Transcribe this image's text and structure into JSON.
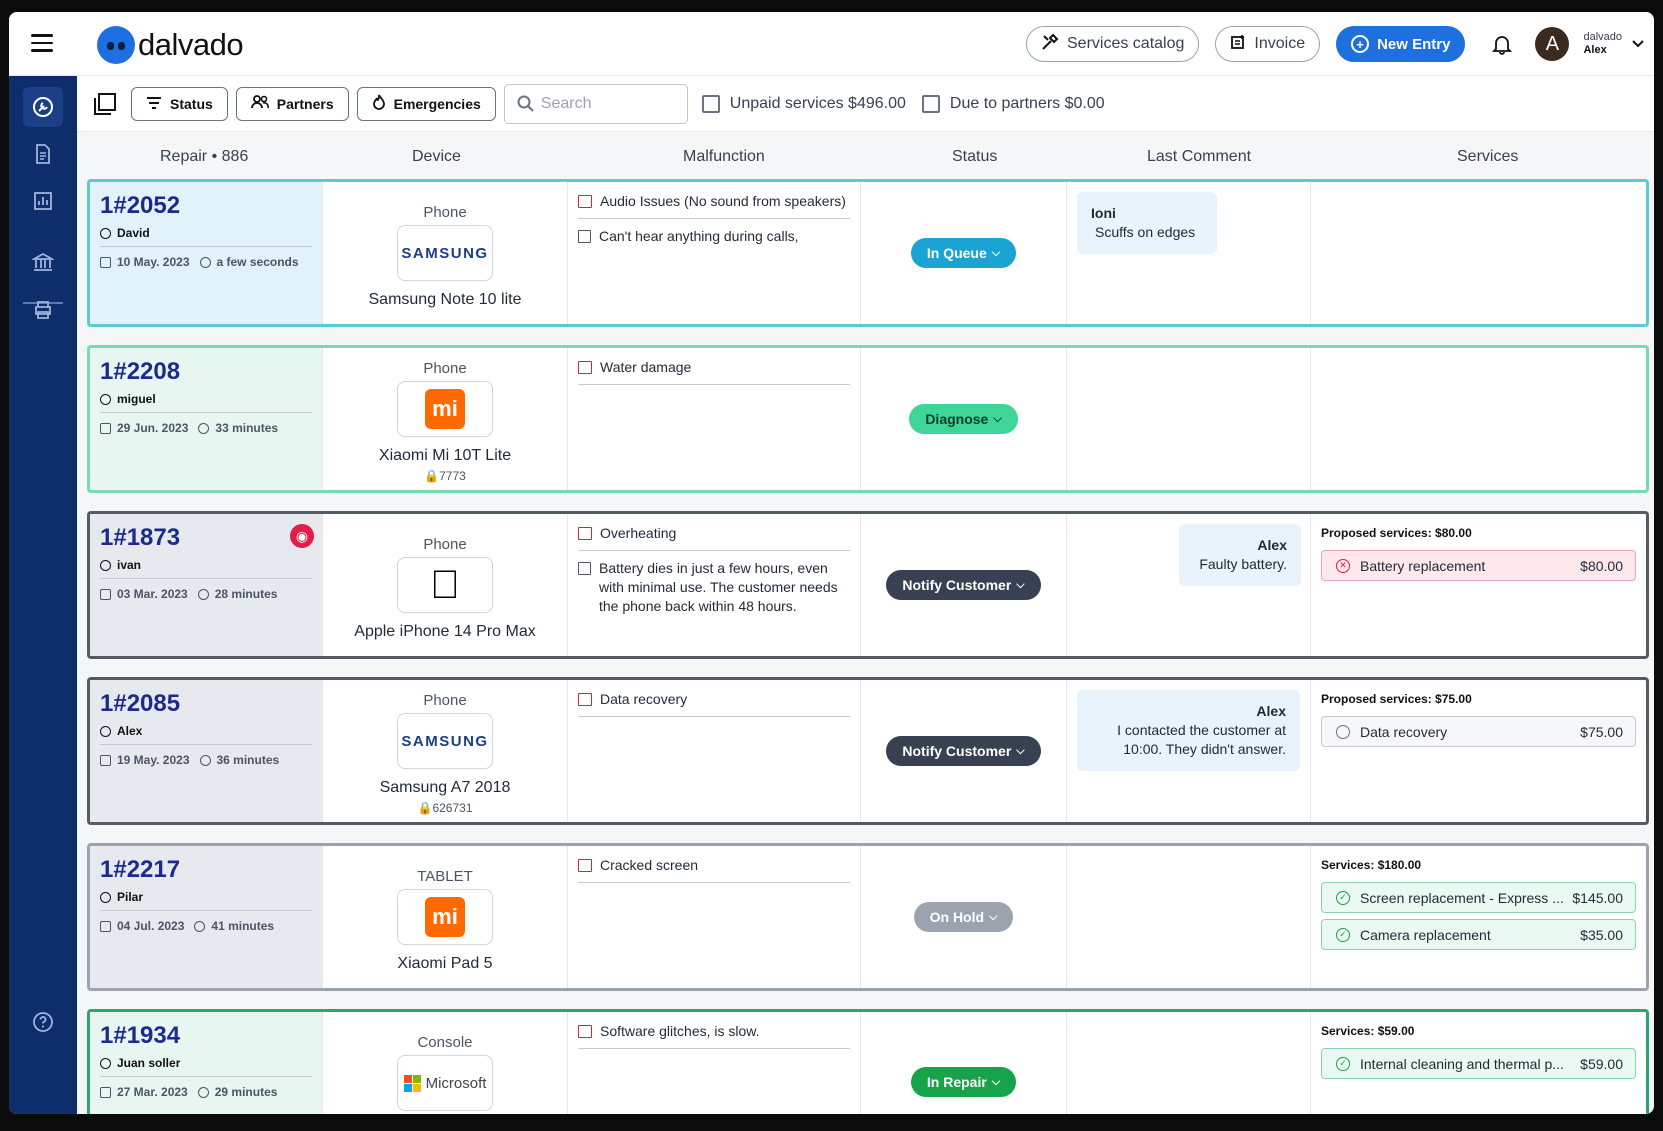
{
  "brand": {
    "name": "dalvado",
    "accent": "#1e6fe0",
    "sidebar_bg": "#0d2d6b"
  },
  "topbar": {
    "services_catalog": "Services catalog",
    "invoice": "Invoice",
    "new_entry": "New Entry",
    "user": {
      "initial": "A",
      "org": "dalvado",
      "name": "Alex"
    }
  },
  "toolbar": {
    "status": "Status",
    "partners": "Partners",
    "emergencies": "Emergencies",
    "search_placeholder": "Search",
    "unpaid": "Unpaid services $496.00",
    "due_partners": "Due to partners $0.00"
  },
  "headers": {
    "repair": "Repair",
    "repair_count": "886",
    "device": "Device",
    "malfunction": "Malfunction",
    "status": "Status",
    "last_comment": "Last Comment",
    "services": "Services"
  },
  "rows": [
    {
      "id": "1#2052",
      "customer": "David",
      "date": "10 May. 2023",
      "ago": "a few seconds",
      "device_type": "Phone",
      "device_name": "Samsung Note 10 lite",
      "brand_logo": "SAMSUNG",
      "pin": "",
      "malfunction": "Audio Issues (No sound from speakers)",
      "note": "Can't hear anything during calls,",
      "status": "In Queue",
      "comment_author": "Ioni",
      "comment_text": "Scuffs on edges",
      "services_header": "",
      "services": []
    },
    {
      "id": "1#2208",
      "customer": "miguel",
      "date": "29 Jun. 2023",
      "ago": "33 minutes",
      "device_type": "Phone",
      "device_name": "Xiaomi Mi 10T Lite",
      "brand_logo": "mi",
      "pin": "7773",
      "malfunction": "Water damage",
      "note": "",
      "status": "Diagnose",
      "comment_author": "",
      "comment_text": "",
      "services_header": "",
      "services": []
    },
    {
      "id": "1#1873",
      "customer": "ivan",
      "date": "03 Mar. 2023",
      "ago": "28 minutes",
      "device_type": "Phone",
      "device_name": "Apple iPhone 14 Pro Max",
      "brand_logo": "apple",
      "pin": "",
      "malfunction": "Overheating",
      "note": "Battery dies in just a few hours, even with minimal use. The customer needs the phone back within 48 hours.",
      "status": "Notify Customer",
      "comment_author": "Alex",
      "comment_text": "Faulty battery.",
      "services_header": "Proposed services: $80.00",
      "services": [
        {
          "name": "Battery replacement",
          "price": "$80.00",
          "state": "rejected"
        }
      ]
    },
    {
      "id": "1#2085",
      "customer": "Alex",
      "date": "19 May. 2023",
      "ago": "36 minutes",
      "device_type": "Phone",
      "device_name": "Samsung A7 2018",
      "brand_logo": "SAMSUNG",
      "pin": "626731",
      "malfunction": "Data recovery",
      "note": "",
      "status": "Notify Customer",
      "comment_author": "Alex",
      "comment_text": "I contacted the customer at 10:00. They didn't answer.",
      "services_header": "Proposed services: $75.00",
      "services": [
        {
          "name": "Data recovery",
          "price": "$75.00",
          "state": "open"
        }
      ]
    },
    {
      "id": "1#2217",
      "customer": "Pilar",
      "date": "04 Jul. 2023",
      "ago": "41 minutes",
      "device_type": "TABLET",
      "device_name": "Xiaomi Pad 5",
      "brand_logo": "mi",
      "pin": "",
      "malfunction": "Cracked screen",
      "note": "",
      "status": "On Hold",
      "comment_author": "",
      "comment_text": "",
      "services_header": "Services: $180.00",
      "services": [
        {
          "name": "Screen replacement - Express ...",
          "price": "$145.00",
          "state": "approved"
        },
        {
          "name": "Camera replacement",
          "price": "$35.00",
          "state": "approved"
        }
      ]
    },
    {
      "id": "1#1934",
      "customer": "Juan soller",
      "date": "27 Mar. 2023",
      "ago": "29 minutes",
      "device_type": "Console",
      "device_name": "",
      "brand_logo": "Microsoft",
      "pin": "",
      "malfunction": "Software glitches, is slow.",
      "note": "",
      "status": "In Repair",
      "comment_author": "",
      "comment_text": "",
      "services_header": "Services: $59.00",
      "services": [
        {
          "name": "Internal cleaning and thermal p...",
          "price": "$59.00",
          "state": "approved"
        }
      ]
    }
  ]
}
